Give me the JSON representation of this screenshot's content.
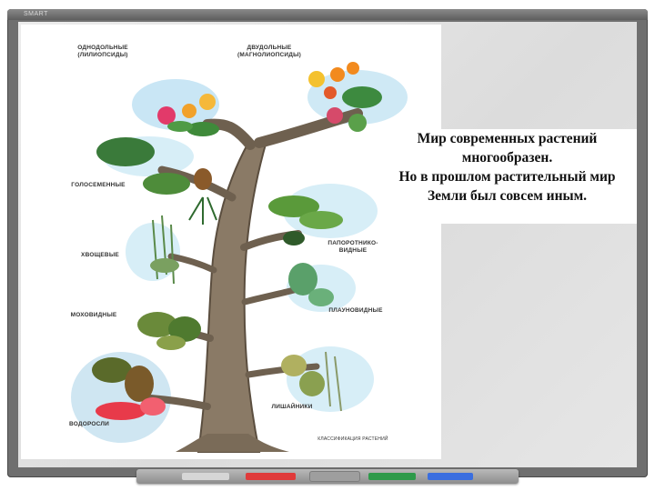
{
  "board": {
    "brand": "SMART",
    "frame_color": "#6f6f6f",
    "surface_color": "#e4e4e4"
  },
  "tray": {
    "pen_colors": [
      "#d6d6d6",
      "#e03a3a",
      "#2e9a4a",
      "#3a6ee0"
    ]
  },
  "illustration": {
    "labels": {
      "monocots_1": "ОДНОДОЛЬНЫЕ",
      "monocots_2": "(ЛИЛИОПСИДЫ)",
      "dicots_1": "ДВУДОЛЬНЫЕ",
      "dicots_2": "(МАГНОЛИОПСИДЫ)",
      "gymnosperms": "ГОЛОСЕМЕННЫЕ",
      "ferns_1": "ПАПОРОТНИКО-",
      "ferns_2": "ВИДНЫЕ",
      "horsetails": "ХВОЩЕВЫЕ",
      "mosses": "МОХОВИДНЫЕ",
      "clubmosses": "ПЛАУНОВИДНЫЕ",
      "lichens": "ЛИШАЙНИКИ",
      "algae": "ВОДОРОСЛИ",
      "footer": "КЛАССИФИКАЦИЯ РАСТЕНИЙ"
    }
  },
  "caption": {
    "line1": "Мир современных растений",
    "line2": "многообразен.",
    "line3": "Но в прошлом растительный мир",
    "line4": "Земли был совсем иным."
  }
}
